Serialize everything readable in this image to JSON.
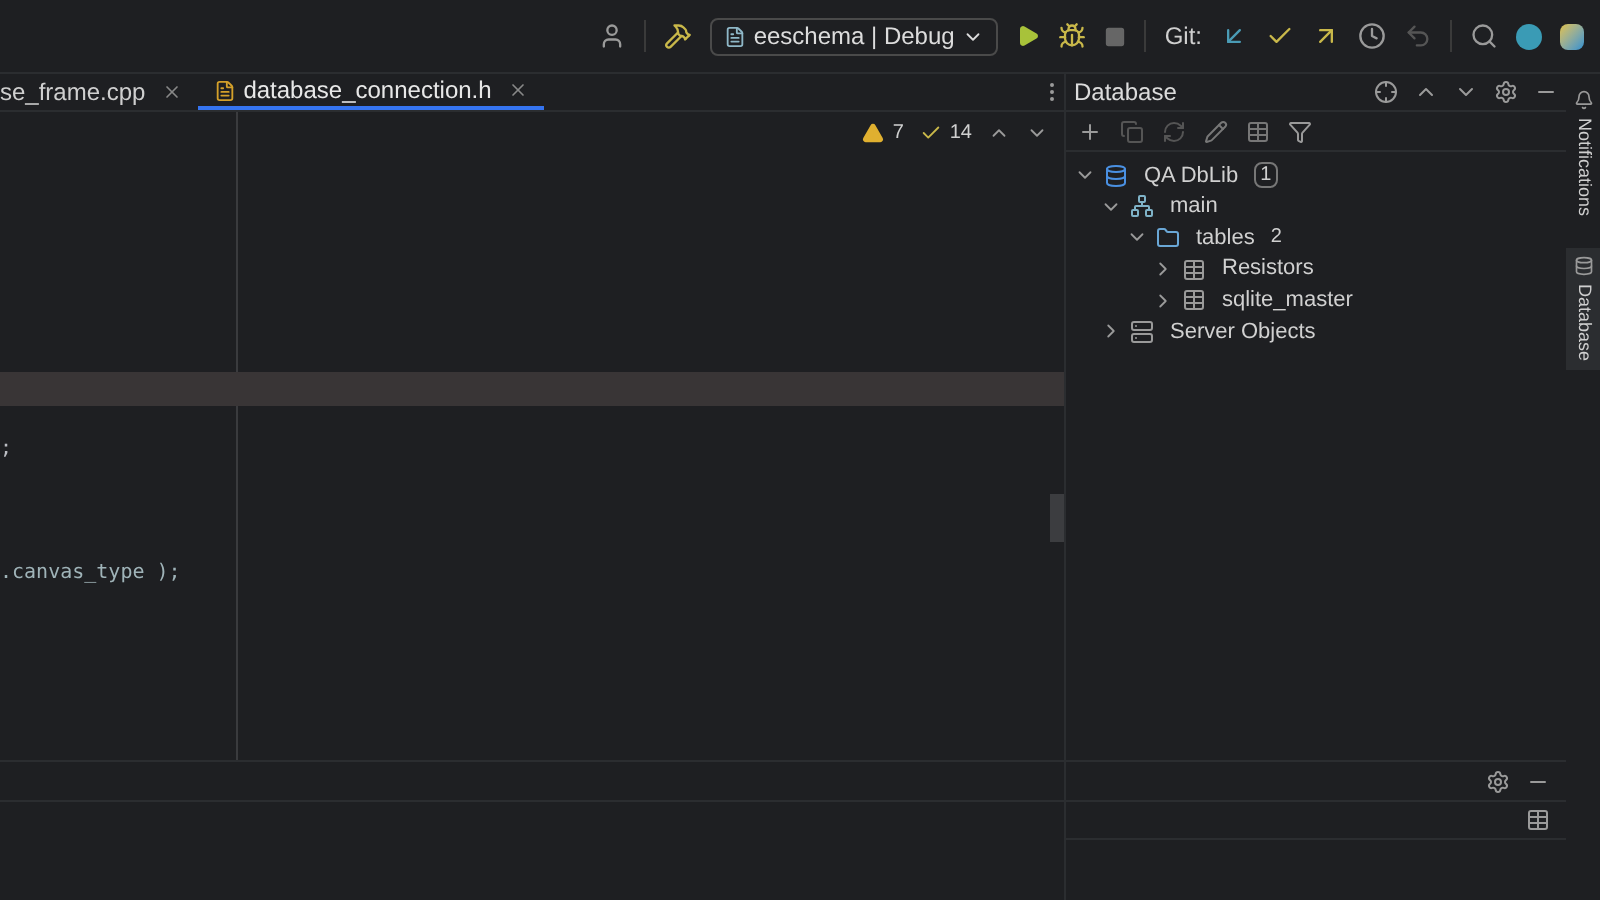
{
  "toolbar": {
    "run_config": "eeschema | Debug",
    "git_label": "Git:"
  },
  "tabs": [
    {
      "label": "se_frame.cpp",
      "selected": false
    },
    {
      "label": "database_connection.h",
      "selected": true
    }
  ],
  "editor": {
    "warnings": "7",
    "checks": "14",
    "code_lines": [
      ";",
      ".canvas_type );"
    ]
  },
  "database": {
    "title": "Database",
    "tree": [
      {
        "label": "QA DbLib",
        "kind": "source",
        "badge": "1",
        "expanded": true,
        "children": [
          {
            "label": "main",
            "kind": "schema",
            "expanded": true,
            "children": [
              {
                "label": "tables",
                "kind": "folder",
                "count": "2",
                "expanded": true,
                "children": [
                  {
                    "label": "Resistors",
                    "kind": "table",
                    "expanded": false
                  },
                  {
                    "label": "sqlite_master",
                    "kind": "table",
                    "expanded": false
                  }
                ]
              }
            ]
          },
          {
            "label": "Server Objects",
            "kind": "server",
            "expanded": false
          }
        ]
      }
    ]
  },
  "side_strip": [
    {
      "label": "Notifications",
      "selected": false
    },
    {
      "label": "Database",
      "selected": true
    }
  ]
}
